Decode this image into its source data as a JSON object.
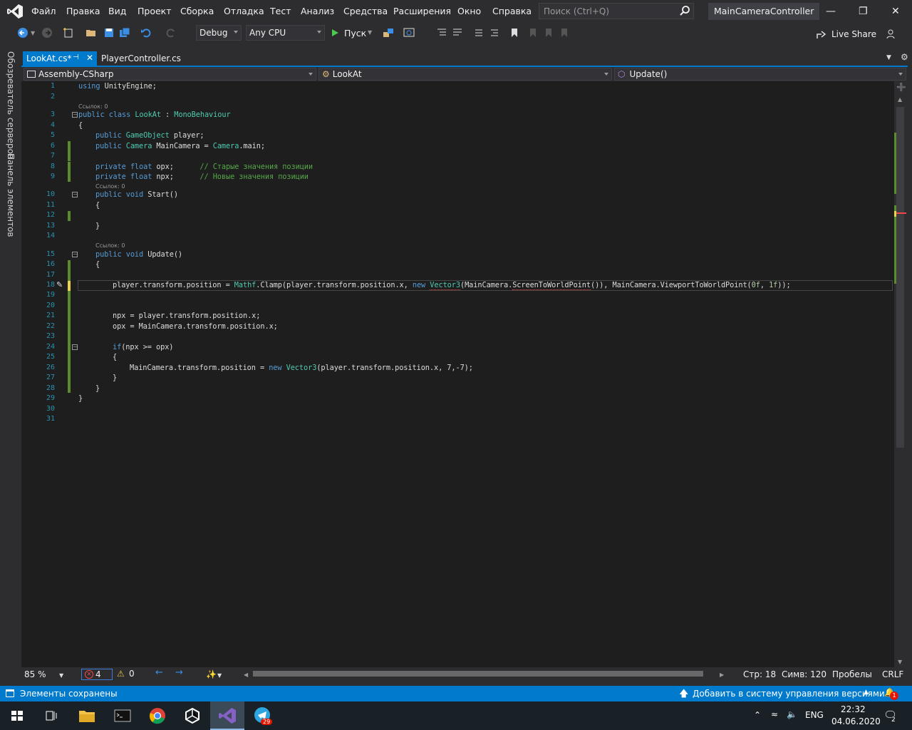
{
  "titlebar": {
    "menu": [
      "Файл",
      "Правка",
      "Вид",
      "Проект",
      "Сборка",
      "Отладка",
      "Тест",
      "Анализ",
      "Средства",
      "Расширения",
      "Окно",
      "Справка"
    ],
    "search_placeholder": "Поиск (Ctrl+Q)",
    "solution_name": "MainCameraController"
  },
  "toolbar": {
    "config": "Debug",
    "platform": "Any CPU",
    "run_label": "Пуск",
    "live_share": "Live Share"
  },
  "side_tabs": [
    "Обозреватель серверов",
    "Панель элементов"
  ],
  "tabs": [
    {
      "label": "LookAt.cs*",
      "active": true
    },
    {
      "label": "PlayerController.cs",
      "active": false
    }
  ],
  "navbar": {
    "project": "Assembly-CSharp",
    "class": "LookAt",
    "member": "Update()"
  },
  "code": {
    "line_numbers": [
      "1",
      "2",
      "3",
      "4",
      "5",
      "6",
      "7",
      "8",
      "9",
      "10",
      "11",
      "12",
      "13",
      "14",
      "15",
      "16",
      "17",
      "18",
      "19",
      "20",
      "21",
      "22",
      "23",
      "24",
      "25",
      "26",
      "27",
      "28",
      "29",
      "30",
      "31"
    ],
    "lens_refs": "Ссылок: 0",
    "lines": {
      "l1": "using UnityEngine;",
      "l5a": "public",
      "l5b": "GameObject",
      "l5c": " player;",
      "l6a": "public",
      "l6b": "Camera",
      "l6c": " MainCamera = ",
      "l6d": "Camera",
      "l6e": ".main;",
      "l8a": "private",
      "l8b": "float",
      "l8c": " opx;      ",
      "l8d": "// Старые значения позиции",
      "l9a": "private",
      "l9b": "float",
      "l9c": " npx;      ",
      "l9d": "// Новые значения позиции",
      "l10a": "public",
      "l10b": "void",
      "l10c": " Start()",
      "l15a": "public",
      "l15b": "void",
      "l15c": " Update()",
      "l18a": "player.transform.position = ",
      "l18b": "Mathf",
      "l18c": ".Clamp(player.transform.position.x, ",
      "l18d": "new",
      "l18e": "Vector3",
      "l18f": "(MainCamera.",
      "l18g": "ScreenToWorldPoint",
      "l18h": "()), MainCamera.ViewportToWorldPoint(",
      "l18i": "0f",
      "l18j": ", ",
      "l18k": "1f",
      "l18l": "));",
      "l21": "npx = player.transform.position.x;",
      "l22": "opx = MainCamera.transform.position.x;",
      "l24a": "if",
      "l24b": "(npx >= opx)",
      "l26a": "MainCamera.transform.position = ",
      "l26b": "new",
      "l26c": "Vector3",
      "l26d": "(player.transform.position.x, 7,-7);",
      "l3a": "public",
      "l3b": "class",
      "l3c": "LookAt",
      "l3d": " : ",
      "l3e": "MonoBehaviour"
    }
  },
  "bottom": {
    "zoom": "85 %",
    "errors": "4",
    "warnings": "0",
    "line": "Стр: 18",
    "col": "Симв: 120",
    "indent": "Пробелы",
    "eol": "CRLF"
  },
  "status": {
    "message": "Элементы сохранены",
    "vcs": "Добавить в систему управления версиями",
    "notifications": "1"
  },
  "taskbar": {
    "lang": "ENG",
    "time": "22:32",
    "date": "04.06.2020",
    "telegram_badge": "29",
    "action_center_badge": "2"
  },
  "colors": {
    "accent": "#007acc",
    "editor_bg": "#1e1e1e",
    "keyword": "#569cd6",
    "type": "#4ec9b0",
    "comment": "#57a64a"
  }
}
